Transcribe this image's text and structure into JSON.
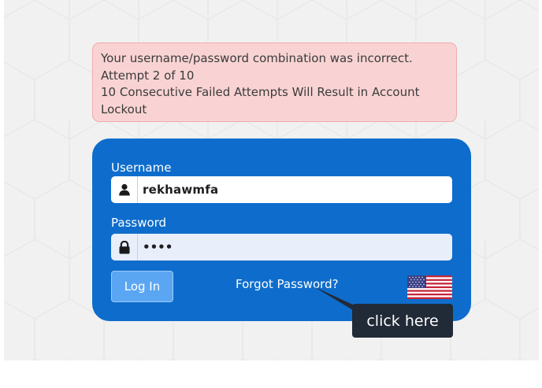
{
  "alert": {
    "line1": "Your username/password combination was incorrect.",
    "line2": "Attempt 2 of 10",
    "line3": "10 Consecutive Failed Attempts Will Result in Account",
    "line4": "Lockout",
    "background_color": "#f9d3d3",
    "border_color": "#f0aaaa"
  },
  "login": {
    "card_color": "#0e6dcc",
    "username_label": "Username",
    "username_value": "rekhawmfa",
    "password_label": "Password",
    "password_value": "••••",
    "submit_label": "Log In",
    "forgot_password_label": "Forgot Password?",
    "language_flag_icon": "us-flag-icon",
    "user_icon": "user-icon",
    "lock_icon": "lock-icon"
  },
  "callout": {
    "label": "click here",
    "background_color": "#212a37"
  }
}
